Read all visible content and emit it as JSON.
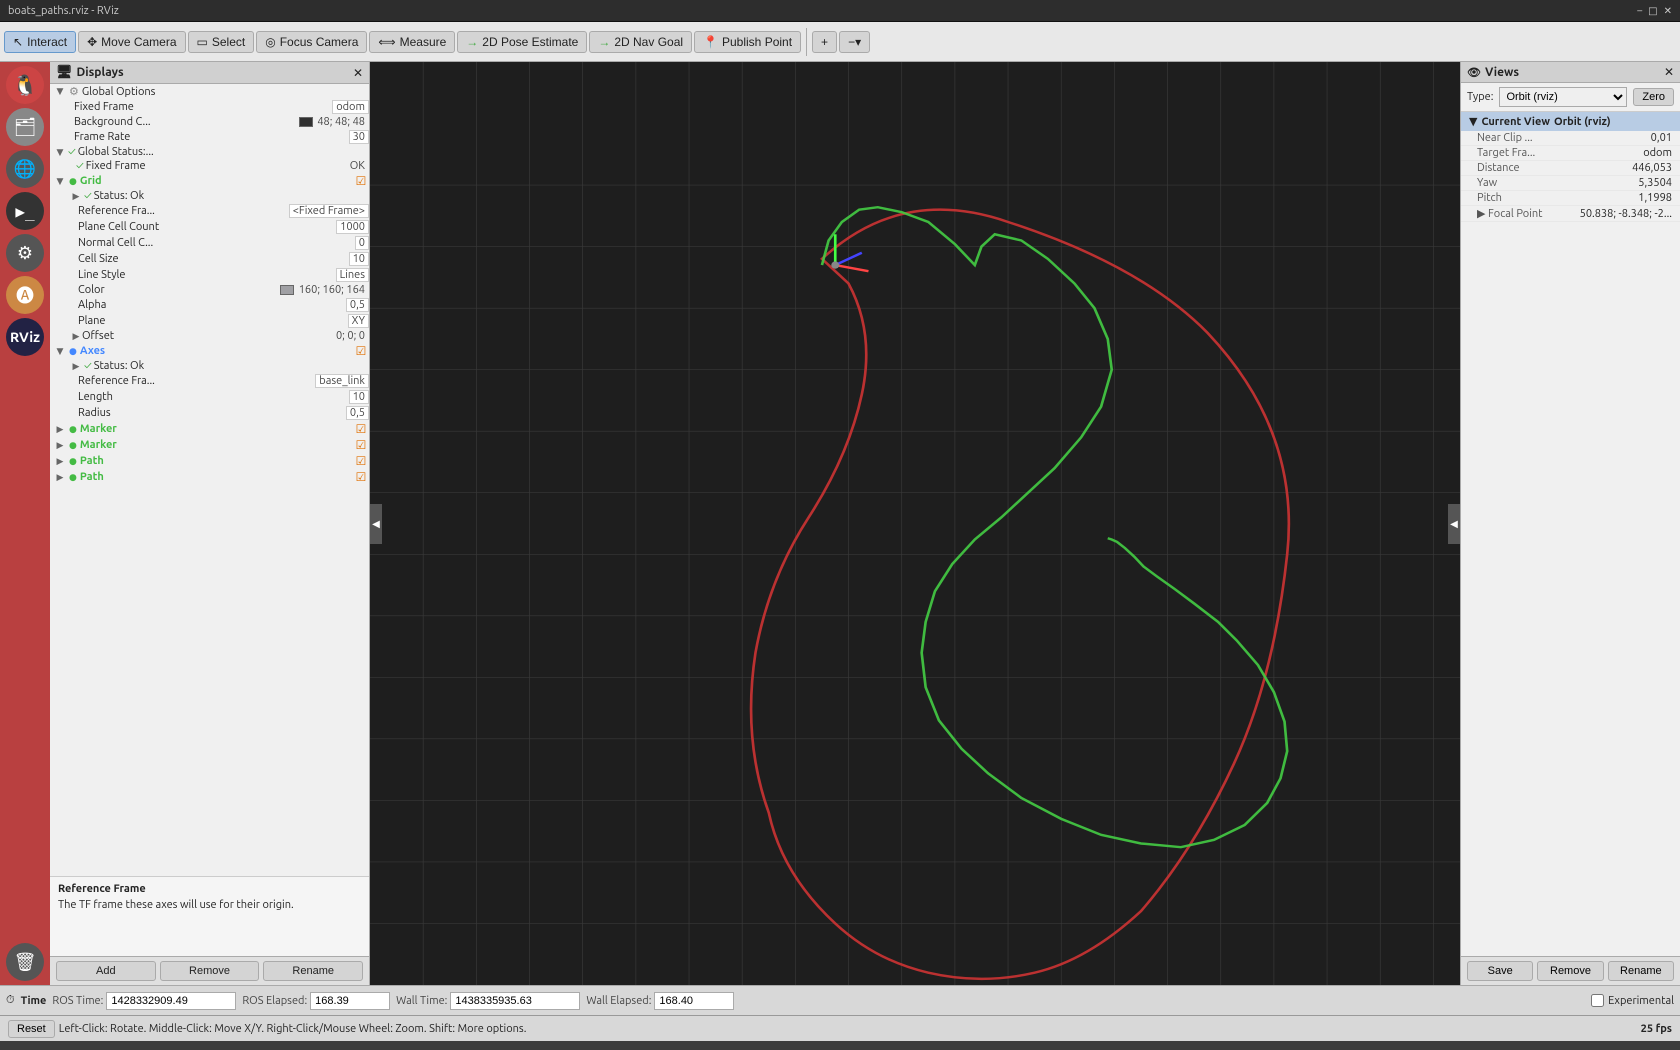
{
  "window": {
    "title": "boats_paths.rviz - RViz"
  },
  "toolbar": {
    "interact": "Interact",
    "move_camera": "Move Camera",
    "select": "Select",
    "focus_camera": "Focus Camera",
    "measure": "Measure",
    "pose_estimate": "2D Pose Estimate",
    "nav_goal": "2D Nav Goal",
    "publish_point": "Publish Point"
  },
  "displays": {
    "title": "Displays",
    "items": {
      "global_options": {
        "label": "Global Options",
        "fixed_frame_label": "Fixed Frame",
        "fixed_frame_value": "odom",
        "background_label": "Background C...",
        "background_value": "48; 48; 48",
        "frame_rate_label": "Frame Rate",
        "frame_rate_value": "30"
      },
      "global_status": {
        "label": "Global Status:...",
        "fixed_frame_label": "Fixed Frame",
        "fixed_frame_value": "OK"
      },
      "grid": {
        "label": "Grid",
        "status_label": "Status: Ok",
        "reference_frame_label": "Reference Fra...",
        "reference_frame_value": "<Fixed Frame>",
        "plane_cell_count_label": "Plane Cell Count",
        "plane_cell_count_value": "1000",
        "normal_cell_label": "Normal Cell C...",
        "normal_cell_value": "0",
        "cell_size_label": "Cell Size",
        "cell_size_value": "10",
        "line_style_label": "Line Style",
        "line_style_value": "Lines",
        "color_label": "Color",
        "color_value": "160; 160; 164",
        "color_hex": "#a0a0a4",
        "alpha_label": "Alpha",
        "alpha_value": "0,5",
        "plane_label": "Plane",
        "plane_value": "XY",
        "offset_label": "Offset",
        "offset_value": "0; 0; 0"
      },
      "axes": {
        "label": "Axes",
        "status_label": "Status: Ok",
        "reference_frame_label": "Reference Fra...",
        "reference_frame_value": "base_link",
        "length_label": "Length",
        "length_value": "10",
        "radius_label": "Radius",
        "radius_value": "0,5"
      },
      "marker1": {
        "label": "Marker"
      },
      "marker2": {
        "label": "Marker"
      },
      "path1": {
        "label": "Path"
      },
      "path2": {
        "label": "Path"
      }
    },
    "info_title": "Reference Frame",
    "info_text": "The TF frame these axes will use for their origin.",
    "buttons": {
      "add": "Add",
      "remove": "Remove",
      "rename": "Rename"
    }
  },
  "views": {
    "title": "Views",
    "type_label": "Type:",
    "type_value": "Orbit (rviz)",
    "zero_label": "Zero",
    "current_view": {
      "label": "Current View",
      "type": "Orbit (rviz)",
      "props": {
        "near_clip_label": "Near Clip ...",
        "near_clip_value": "0,01",
        "target_frame_label": "Target Fra...",
        "target_frame_value": "odom",
        "distance_label": "Distance",
        "distance_value": "446,053",
        "yaw_label": "Yaw",
        "yaw_value": "5,3504",
        "pitch_label": "Pitch",
        "pitch_value": "1,1998",
        "focal_point_label": "▶ Focal Point",
        "focal_point_value": "50.838; -8.348; -2..."
      }
    },
    "buttons": {
      "save": "Save",
      "remove": "Remove",
      "rename": "Rename"
    }
  },
  "time": {
    "icon": "⏱",
    "label": "Time",
    "ros_time_label": "ROS Time:",
    "ros_time_value": "1428332909.49",
    "ros_elapsed_label": "ROS Elapsed:",
    "ros_elapsed_value": "168.39",
    "wall_time_label": "Wall Time:",
    "wall_time_value": "1438335935.63",
    "wall_elapsed_label": "Wall Elapsed:",
    "wall_elapsed_value": "168.40",
    "experimental_label": "Experimental"
  },
  "status_bar": {
    "reset_label": "Reset",
    "help_text": "Left-Click: Rotate.  Middle-Click: Move X/Y.  Right-Click/Mouse Wheel: Zoom.  Shift: More options.",
    "fps": "25 fps"
  }
}
